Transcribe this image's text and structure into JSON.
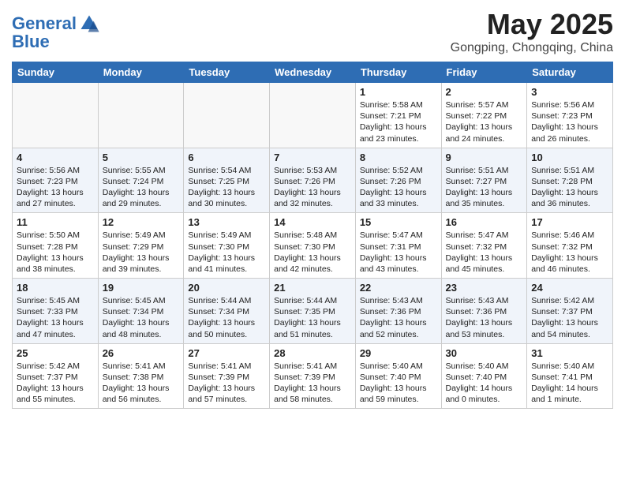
{
  "header": {
    "logo_general": "General",
    "logo_blue": "Blue",
    "month_year": "May 2025",
    "location": "Gongping, Chongqing, China"
  },
  "weekdays": [
    "Sunday",
    "Monday",
    "Tuesday",
    "Wednesday",
    "Thursday",
    "Friday",
    "Saturday"
  ],
  "weeks": [
    [
      {
        "day": "",
        "info": ""
      },
      {
        "day": "",
        "info": ""
      },
      {
        "day": "",
        "info": ""
      },
      {
        "day": "",
        "info": ""
      },
      {
        "day": "1",
        "info": "Sunrise: 5:58 AM\nSunset: 7:21 PM\nDaylight: 13 hours\nand 23 minutes."
      },
      {
        "day": "2",
        "info": "Sunrise: 5:57 AM\nSunset: 7:22 PM\nDaylight: 13 hours\nand 24 minutes."
      },
      {
        "day": "3",
        "info": "Sunrise: 5:56 AM\nSunset: 7:23 PM\nDaylight: 13 hours\nand 26 minutes."
      }
    ],
    [
      {
        "day": "4",
        "info": "Sunrise: 5:56 AM\nSunset: 7:23 PM\nDaylight: 13 hours\nand 27 minutes."
      },
      {
        "day": "5",
        "info": "Sunrise: 5:55 AM\nSunset: 7:24 PM\nDaylight: 13 hours\nand 29 minutes."
      },
      {
        "day": "6",
        "info": "Sunrise: 5:54 AM\nSunset: 7:25 PM\nDaylight: 13 hours\nand 30 minutes."
      },
      {
        "day": "7",
        "info": "Sunrise: 5:53 AM\nSunset: 7:26 PM\nDaylight: 13 hours\nand 32 minutes."
      },
      {
        "day": "8",
        "info": "Sunrise: 5:52 AM\nSunset: 7:26 PM\nDaylight: 13 hours\nand 33 minutes."
      },
      {
        "day": "9",
        "info": "Sunrise: 5:51 AM\nSunset: 7:27 PM\nDaylight: 13 hours\nand 35 minutes."
      },
      {
        "day": "10",
        "info": "Sunrise: 5:51 AM\nSunset: 7:28 PM\nDaylight: 13 hours\nand 36 minutes."
      }
    ],
    [
      {
        "day": "11",
        "info": "Sunrise: 5:50 AM\nSunset: 7:28 PM\nDaylight: 13 hours\nand 38 minutes."
      },
      {
        "day": "12",
        "info": "Sunrise: 5:49 AM\nSunset: 7:29 PM\nDaylight: 13 hours\nand 39 minutes."
      },
      {
        "day": "13",
        "info": "Sunrise: 5:49 AM\nSunset: 7:30 PM\nDaylight: 13 hours\nand 41 minutes."
      },
      {
        "day": "14",
        "info": "Sunrise: 5:48 AM\nSunset: 7:30 PM\nDaylight: 13 hours\nand 42 minutes."
      },
      {
        "day": "15",
        "info": "Sunrise: 5:47 AM\nSunset: 7:31 PM\nDaylight: 13 hours\nand 43 minutes."
      },
      {
        "day": "16",
        "info": "Sunrise: 5:47 AM\nSunset: 7:32 PM\nDaylight: 13 hours\nand 45 minutes."
      },
      {
        "day": "17",
        "info": "Sunrise: 5:46 AM\nSunset: 7:32 PM\nDaylight: 13 hours\nand 46 minutes."
      }
    ],
    [
      {
        "day": "18",
        "info": "Sunrise: 5:45 AM\nSunset: 7:33 PM\nDaylight: 13 hours\nand 47 minutes."
      },
      {
        "day": "19",
        "info": "Sunrise: 5:45 AM\nSunset: 7:34 PM\nDaylight: 13 hours\nand 48 minutes."
      },
      {
        "day": "20",
        "info": "Sunrise: 5:44 AM\nSunset: 7:34 PM\nDaylight: 13 hours\nand 50 minutes."
      },
      {
        "day": "21",
        "info": "Sunrise: 5:44 AM\nSunset: 7:35 PM\nDaylight: 13 hours\nand 51 minutes."
      },
      {
        "day": "22",
        "info": "Sunrise: 5:43 AM\nSunset: 7:36 PM\nDaylight: 13 hours\nand 52 minutes."
      },
      {
        "day": "23",
        "info": "Sunrise: 5:43 AM\nSunset: 7:36 PM\nDaylight: 13 hours\nand 53 minutes."
      },
      {
        "day": "24",
        "info": "Sunrise: 5:42 AM\nSunset: 7:37 PM\nDaylight: 13 hours\nand 54 minutes."
      }
    ],
    [
      {
        "day": "25",
        "info": "Sunrise: 5:42 AM\nSunset: 7:37 PM\nDaylight: 13 hours\nand 55 minutes."
      },
      {
        "day": "26",
        "info": "Sunrise: 5:41 AM\nSunset: 7:38 PM\nDaylight: 13 hours\nand 56 minutes."
      },
      {
        "day": "27",
        "info": "Sunrise: 5:41 AM\nSunset: 7:39 PM\nDaylight: 13 hours\nand 57 minutes."
      },
      {
        "day": "28",
        "info": "Sunrise: 5:41 AM\nSunset: 7:39 PM\nDaylight: 13 hours\nand 58 minutes."
      },
      {
        "day": "29",
        "info": "Sunrise: 5:40 AM\nSunset: 7:40 PM\nDaylight: 13 hours\nand 59 minutes."
      },
      {
        "day": "30",
        "info": "Sunrise: 5:40 AM\nSunset: 7:40 PM\nDaylight: 14 hours\nand 0 minutes."
      },
      {
        "day": "31",
        "info": "Sunrise: 5:40 AM\nSunset: 7:41 PM\nDaylight: 14 hours\nand 1 minute."
      }
    ]
  ]
}
